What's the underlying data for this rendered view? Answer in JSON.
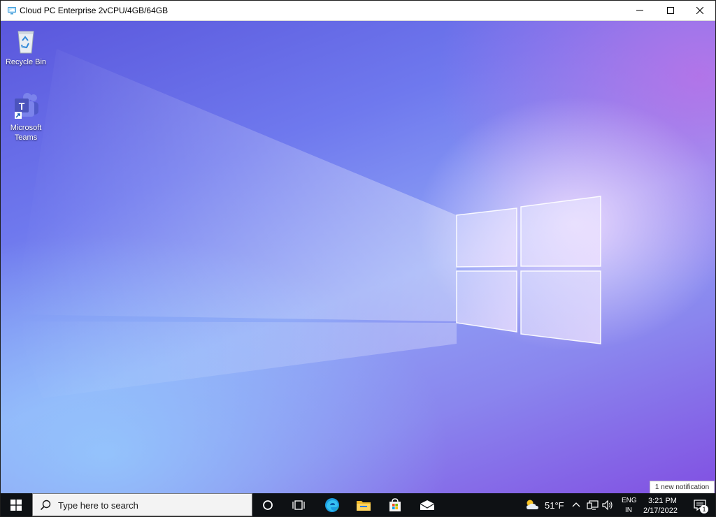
{
  "window": {
    "title": "Cloud PC Enterprise 2vCPU/4GB/64GB"
  },
  "desktop": {
    "icons": [
      {
        "label": "Recycle Bin",
        "icon": "recycle-bin-icon"
      },
      {
        "label": "Microsoft Teams",
        "icon": "teams-icon"
      }
    ]
  },
  "notification": {
    "toast_text": "1 new notification",
    "badge_count": "1"
  },
  "taskbar": {
    "search_placeholder": "Type here to search",
    "weather": {
      "temp": "51°F",
      "icon": "partly-cloudy-icon"
    },
    "language": {
      "line1": "ENG",
      "line2": "IN"
    },
    "clock": {
      "time": "3:21 PM",
      "date": "2/17/2022"
    },
    "pinned": [
      "cortana-icon",
      "task-view-icon",
      "edge-icon",
      "file-explorer-icon",
      "store-icon",
      "mail-icon"
    ]
  },
  "colors": {
    "taskbar": "#0e1114",
    "accent": "#0078d4",
    "close_hover": "#e81123"
  }
}
